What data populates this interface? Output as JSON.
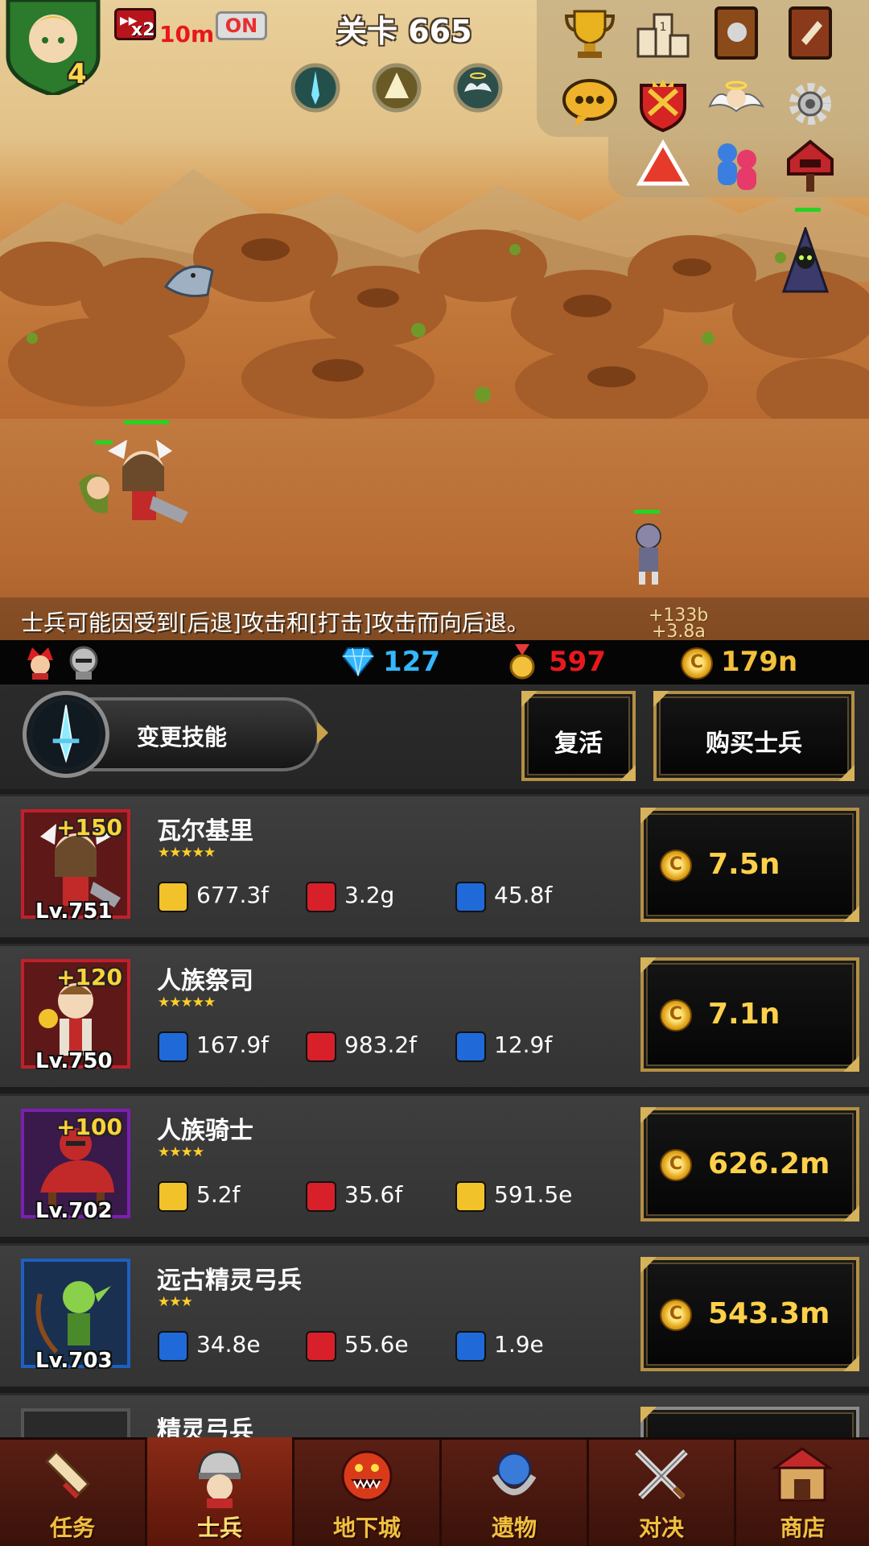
{
  "hud": {
    "hero_level": "4",
    "speed_multiplier": "x2",
    "speed_time": "10m",
    "auto_toggle": "ON",
    "stage_title": "关卡 665"
  },
  "top_menu": {
    "icons": [
      "trophy-icon",
      "ranking-podium-icon",
      "helmet-book-icon",
      "quest-book-icon",
      "chat-bubble-icon",
      "guild-crest-icon",
      "angel-icon",
      "settings-gear-icon",
      "warning-triangle-icon",
      "friends-icon",
      "mailbox-icon"
    ]
  },
  "battle": {
    "hint": "士兵可能因受到[后退]攻击和[打击]攻击而向后退。",
    "floating_numbers": [
      "+133b",
      "+3.8a"
    ]
  },
  "currency": {
    "gems": "127",
    "medals": "597",
    "gold": "179n",
    "gem_color": "#33b8ff",
    "medal_color": "#e8191c",
    "gold_color": "#f2c03a"
  },
  "actions": {
    "change_skill": "变更技能",
    "revive": "复活",
    "buy_soldier": "购买士兵"
  },
  "soldiers": [
    {
      "name": "瓦尔基里",
      "level": "Lv.751",
      "bonus": "+150",
      "stars": "★★★★★",
      "attack": "677.3f",
      "hp": "3.2g",
      "defense": "45.8f",
      "price": "7.5n",
      "frame": "#c0202a"
    },
    {
      "name": "人族祭司",
      "level": "Lv.750",
      "bonus": "+120",
      "stars": "★★★★★",
      "attack": "167.9f",
      "hp": "983.2f",
      "defense": "12.9f",
      "price": "7.1n",
      "frame": "#c0202a"
    },
    {
      "name": "人族骑士",
      "level": "Lv.702",
      "bonus": "+100",
      "stars": "★★★★",
      "attack": "5.2f",
      "hp": "35.6f",
      "defense": "591.5e",
      "price": "626.2m",
      "frame": "#7b1fb0"
    },
    {
      "name": "远古精灵弓兵",
      "level": "Lv.703",
      "bonus": "",
      "stars": "★★★",
      "attack": "34.8e",
      "hp": "55.6e",
      "defense": "1.9e",
      "price": "543.3m",
      "frame": "#1f5fc0"
    },
    {
      "name": "精灵弓兵",
      "level": "",
      "bonus": "",
      "stars": "",
      "attack": "",
      "hp": "",
      "defense": "",
      "price": "",
      "frame": "#555555"
    }
  ],
  "nav": [
    {
      "label": "任务",
      "icon": "scroll-icon"
    },
    {
      "label": "士兵",
      "icon": "soldier-helmet-icon"
    },
    {
      "label": "地下城",
      "icon": "dungeon-monster-icon"
    },
    {
      "label": "遗物",
      "icon": "relic-orb-icon"
    },
    {
      "label": "对决",
      "icon": "crossed-swords-icon"
    },
    {
      "label": "商店",
      "icon": "shop-icon"
    }
  ]
}
